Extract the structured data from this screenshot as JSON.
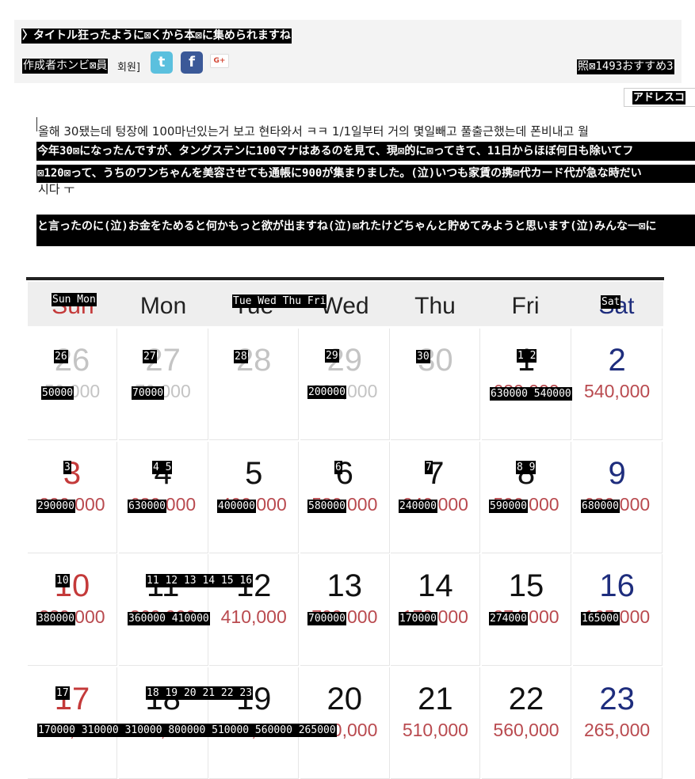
{
  "post": {
    "title_overlay": "〉タイトル狂ったように⊠くから本⊠に集められますね",
    "author_overlay": "作成者ホンビ⊠員",
    "author_suffix": "회원]",
    "share_icons": [
      "twitter-icon",
      "facebook-icon",
      "google-plus-icon"
    ],
    "twitter_glyph": "t",
    "facebook_glyph": "f",
    "gplus_glyph": "G+",
    "stats_overlay": "照⊠1493おすすめ3",
    "address_button_overlay": "アドレスコ",
    "body_korean_line1": "올해 30됐는데 텅장에 100마넌있는거 보고 현타와서 ㅋㅋ 1/1일부터 거의 몇일빼고 풀출근했는데 폰비내고 월",
    "body_korean_line3": "시다 ㅜ",
    "body_overlay_1": "今年30⊠になったんですが、タングステンに100マナはあるのを見て、現⊠的に⊠ってきて、11日からほぼ何日も除いてフ",
    "body_overlay_2": "⊠120⊠って、うちのワンちゃんを美容させても通帳に900が集まりました。(泣)いつも家賃の携⊠代カード代が急な時だい",
    "body_overlay_3": "と言ったのに(泣)お金をためると何かもっと欲が出ますね(泣)⊠れたけどちゃんと貯めてみようと思います(泣)みんな一⊠に"
  },
  "calendar": {
    "weekdays": [
      "Sun",
      "Mon",
      "Tue",
      "Wed",
      "Thu",
      "Fri",
      "Sat"
    ],
    "weeks": [
      {
        "dates": [
          "26",
          "27",
          "28",
          "29",
          "30",
          "1",
          "2"
        ],
        "values": [
          "50,000",
          "70,000",
          "",
          "200,000",
          "",
          "630,000",
          "540,000"
        ]
      },
      {
        "dates": [
          "3",
          "4",
          "5",
          "6",
          "7",
          "8",
          "9"
        ],
        "values": [
          "290,000",
          "630,000",
          "400,000",
          "580,000",
          "240,000",
          "590,000",
          "680,000"
        ]
      },
      {
        "dates": [
          "10",
          "11",
          "12",
          "13",
          "14",
          "15",
          "16"
        ],
        "values": [
          "380,000",
          "360,000",
          "410,000",
          "700,000",
          "170,000",
          "274,000",
          "165,000"
        ]
      },
      {
        "dates": [
          "17",
          "18",
          "19",
          "20",
          "21",
          "22",
          "23"
        ],
        "values": [
          "170,000",
          "310,000",
          "310,000",
          "800,000",
          "510,000",
          "560,000",
          "265,000"
        ]
      }
    ],
    "colors": {
      "sunday": "#c43a3a",
      "saturday": "#1e2d7d",
      "amount": "#b94a4f",
      "other_month": "#c4c4c4"
    },
    "overlays": {
      "head_sun_mon": "Sun Mon",
      "head_tue_fri": "Tue Wed Thu Fri",
      "head_sat": "Sat",
      "r1_d26": "26",
      "r1_d27": "27",
      "r1_d28": "28",
      "r1_d29": "29",
      "r1_d30": "30",
      "r1_d1_2": "1 2",
      "r1_v26": "50000",
      "r1_v27": "70000",
      "r1_v29": "200000",
      "r1_v1_2": "630000 540000",
      "r2_d3": "3",
      "r2_d4_5": "4 5",
      "r2_d6": "6",
      "r2_d7": "7",
      "r2_d8_9": "8 9",
      "r2_v": [
        "290000",
        "630000",
        "400000",
        "580000",
        "240000",
        "590000",
        "680000"
      ],
      "r3_d10": "10",
      "r3_d11_16": "11 12 13 14 15 16",
      "r3_v10": "380000",
      "r3_v11_12": "360000 410000",
      "r3_v13": "700000",
      "r3_v14": "170000",
      "r3_v15": "274000",
      "r3_v16": "165000",
      "r4_d17": "17",
      "r4_d18_23": "18 19 20 21 22 23",
      "r4_vals": "170000 310000 310000 800000 510000 560000 265000"
    }
  }
}
